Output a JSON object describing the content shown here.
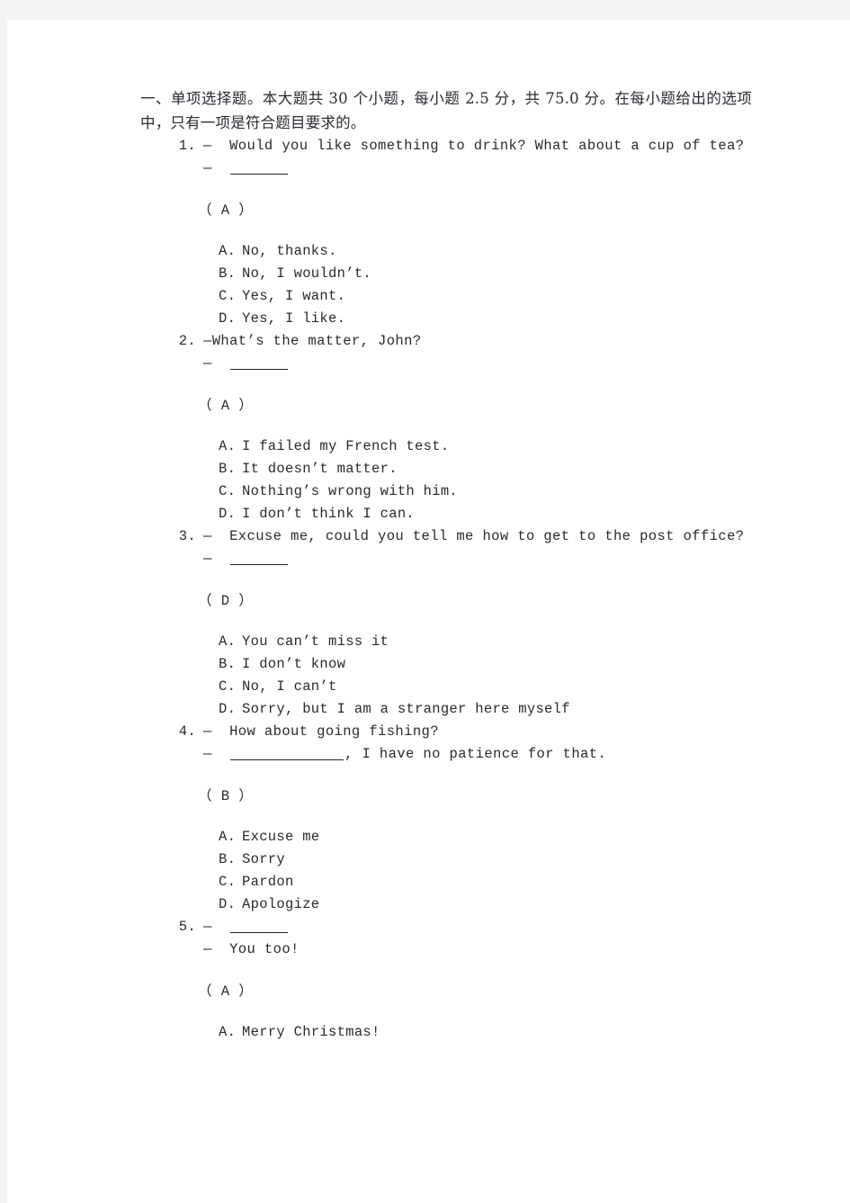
{
  "document": {
    "section_heading": "一、单项选择题。本大题共 30 个小题，每小题 2.5 分，共 75.0 分。在每小题给出的选项中，只有一项是符合题目要求的。",
    "questions": [
      {
        "number": "1.",
        "prompt_line": "—  Would you like something to drink? What about a cup of tea?",
        "reply_prefix": "—  ",
        "blank": "short",
        "reply_suffix": "",
        "answer_key": "（ A ）",
        "options": [
          {
            "letter": "A.",
            "text": "No, thanks."
          },
          {
            "letter": "B.",
            "text": "No, I wouldn’t."
          },
          {
            "letter": "C.",
            "text": "Yes, I want."
          },
          {
            "letter": "D.",
            "text": "Yes, I like."
          }
        ]
      },
      {
        "number": "2.",
        "prompt_line": "—What’s the matter, John?",
        "reply_prefix": "—  ",
        "blank": "short",
        "reply_suffix": "",
        "answer_key": "（ A ）",
        "options": [
          {
            "letter": "A.",
            "text": "I failed my French test."
          },
          {
            "letter": "B.",
            "text": "It doesn’t matter."
          },
          {
            "letter": "C.",
            "text": "Nothing’s wrong with him."
          },
          {
            "letter": "D.",
            "text": "I don’t think I can."
          }
        ]
      },
      {
        "number": "3.",
        "prompt_line": "—  Excuse me, could you tell me how to get to the post office?",
        "reply_prefix": "—  ",
        "blank": "short",
        "reply_suffix": "",
        "answer_key": "（ D ）",
        "options": [
          {
            "letter": "A.",
            "text": "You can’t miss it"
          },
          {
            "letter": "B.",
            "text": "I don’t know"
          },
          {
            "letter": "C.",
            "text": "No, I can’t"
          },
          {
            "letter": "D.",
            "text": "Sorry, but I am a stranger here myself"
          }
        ]
      },
      {
        "number": "4.",
        "prompt_line": "—  How about going fishing?",
        "reply_prefix": "—  ",
        "blank": "long",
        "reply_suffix": ", I have no patience for that.",
        "answer_key": "（ B ）",
        "options": [
          {
            "letter": "A.",
            "text": "Excuse me"
          },
          {
            "letter": "B.",
            "text": "Sorry"
          },
          {
            "letter": "C.",
            "text": "Pardon"
          },
          {
            "letter": "D.",
            "text": "Apologize"
          }
        ]
      },
      {
        "number": "5.",
        "prompt_prefix": "—  ",
        "prompt_blank": "short",
        "prompt_line": "",
        "reply_prefix": "—  You too!",
        "blank": "none",
        "reply_suffix": "",
        "answer_key": "（ A ）",
        "options": [
          {
            "letter": "A.",
            "text": "Merry Christmas!"
          }
        ]
      }
    ]
  },
  "colors": {
    "page_background": "#ffffff",
    "canvas_background": "#f4f4f4",
    "text": "#2a2a30"
  }
}
